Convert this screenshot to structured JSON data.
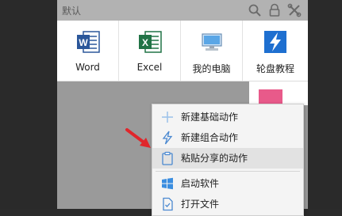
{
  "window": {
    "title": "默认"
  },
  "toolbar": {
    "search_icon": "search-icon",
    "lock_icon": "lock-icon",
    "tools_icon": "tools-icon"
  },
  "tiles": [
    {
      "label": "Word",
      "icon": "word-icon"
    },
    {
      "label": "Excel",
      "icon": "excel-icon"
    },
    {
      "label": "我的电脑",
      "icon": "computer-icon"
    },
    {
      "label": "轮盘教程",
      "icon": "lightning-icon"
    }
  ],
  "context_menu": {
    "items": [
      {
        "label": "新建基础动作",
        "icon": "plus-icon"
      },
      {
        "label": "新建组合动作",
        "icon": "lightning-icon"
      },
      {
        "label": "粘贴分享的动作",
        "icon": "clipboard-icon",
        "highlighted": true
      },
      {
        "label": "启动软件",
        "icon": "windows-icon"
      },
      {
        "label": "打开文件",
        "icon": "file-icon"
      }
    ]
  },
  "colors": {
    "accent_blue": "#2b7bd8",
    "word_blue": "#2b579a",
    "excel_green": "#217346",
    "arrow_red": "#e0262b"
  }
}
